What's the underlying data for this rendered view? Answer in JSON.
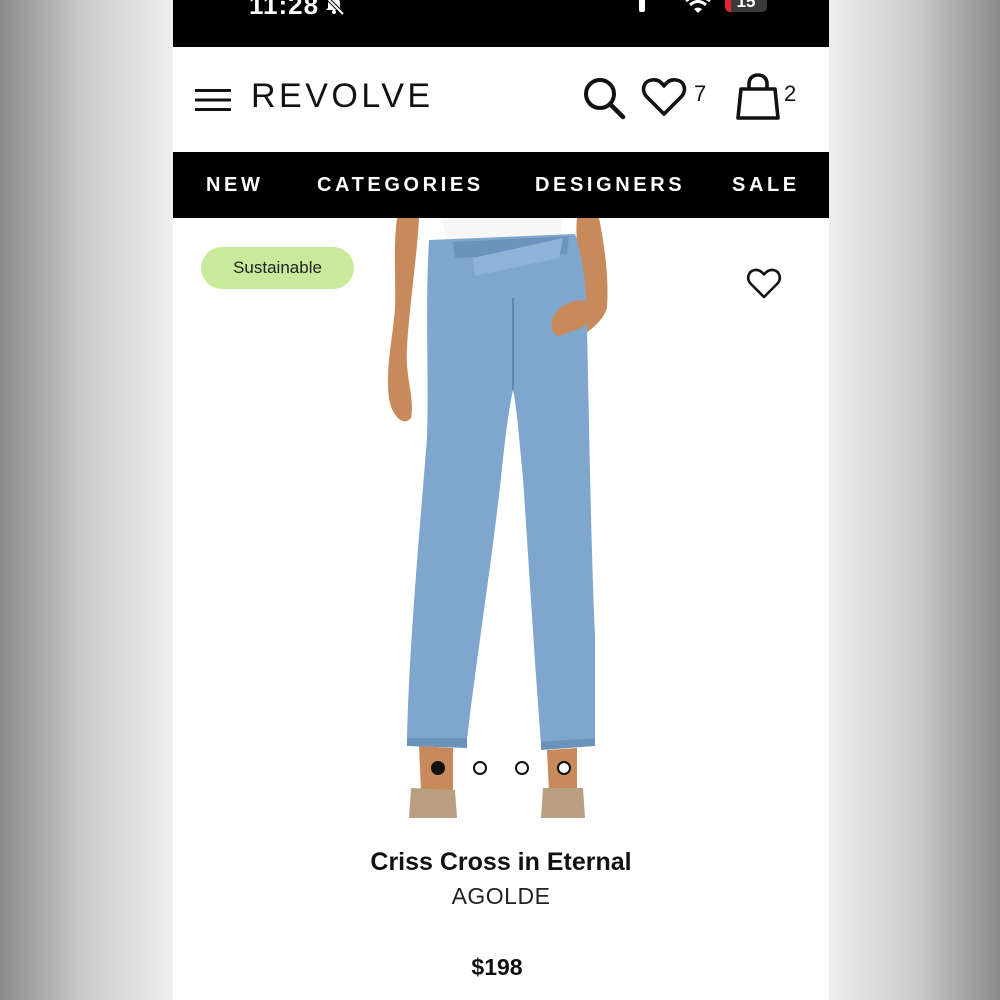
{
  "status_bar": {
    "time": "11:28",
    "battery_level_text": "15",
    "battery_fraction": 0.15,
    "icons": [
      "bell-off-icon",
      "signal-icon",
      "wifi-icon",
      "battery-icon"
    ]
  },
  "header": {
    "brand": "REVOLVE",
    "wishlist_count": "7",
    "bag_count": "2",
    "icons": [
      "menu-icon",
      "search-icon",
      "heart-icon",
      "bag-icon"
    ]
  },
  "nav": {
    "items": [
      {
        "label": "NEW"
      },
      {
        "label": "CATEGORIES"
      },
      {
        "label": "DESIGNERS"
      },
      {
        "label": "SALE"
      }
    ]
  },
  "product": {
    "badge": "Sustainable",
    "name": "Criss Cross in Eternal",
    "brand": "AGOLDE",
    "price": "$198",
    "image_count": 4,
    "active_image_index": 0
  },
  "colors": {
    "badge_bg": "#c9ea9c",
    "nav_bg": "#000000",
    "battery_low": "#e0242a",
    "denim": "#7fa6cc"
  }
}
